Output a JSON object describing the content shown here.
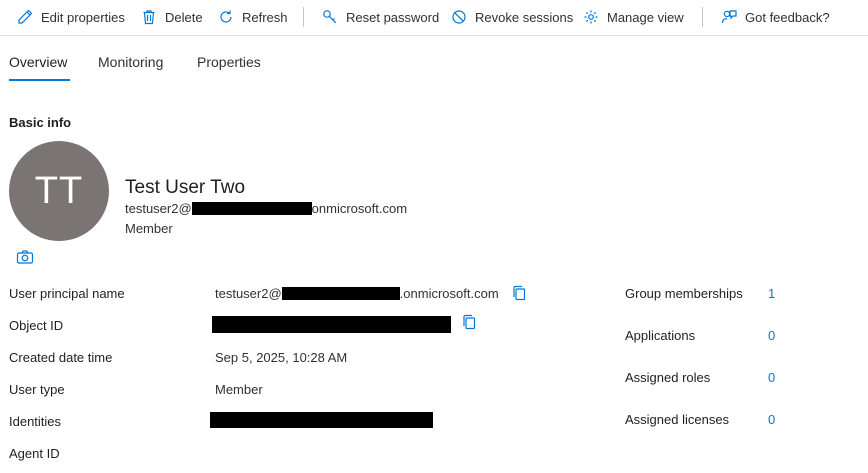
{
  "toolbar": {
    "edit_label": "Edit properties",
    "delete_label": "Delete",
    "refresh_label": "Refresh",
    "reset_password_label": "Reset password",
    "revoke_sessions_label": "Revoke sessions",
    "manage_view_label": "Manage view",
    "feedback_label": "Got feedback?"
  },
  "tabs": [
    {
      "label": "Overview",
      "active": true
    },
    {
      "label": "Monitoring",
      "active": false
    },
    {
      "label": "Properties",
      "active": false
    }
  ],
  "basic_info": {
    "section_title": "Basic info",
    "initials": "TT",
    "display_name": "Test User Two",
    "email_prefix": "testuser2@",
    "email_suffix": "onmicrosoft.com",
    "user_type": "Member"
  },
  "properties": {
    "upn_label": "User principal name",
    "upn_prefix": "testuser2@",
    "upn_suffix": ".onmicrosoft.com",
    "object_id_label": "Object ID",
    "created_label": "Created date time",
    "created_value": "Sep 5, 2025, 10:28 AM",
    "user_type_label": "User type",
    "user_type_value": "Member",
    "identities_label": "Identities",
    "agent_id_label": "Agent ID"
  },
  "side_stats": {
    "group_memberships_label": "Group memberships",
    "group_memberships_value": "1",
    "applications_label": "Applications",
    "applications_value": "0",
    "assigned_roles_label": "Assigned roles",
    "assigned_roles_value": "0",
    "assigned_licenses_label": "Assigned licenses",
    "assigned_licenses_value": "0"
  },
  "colors": {
    "accent": "#0078d4",
    "avatar_bg": "#7a7574",
    "text": "#323130",
    "redaction": "#000000"
  },
  "icons": [
    "pencil-icon",
    "trash-icon",
    "refresh-icon",
    "key-icon",
    "block-icon",
    "gear-icon",
    "feedback-icon",
    "camera-icon",
    "copy-icon"
  ]
}
